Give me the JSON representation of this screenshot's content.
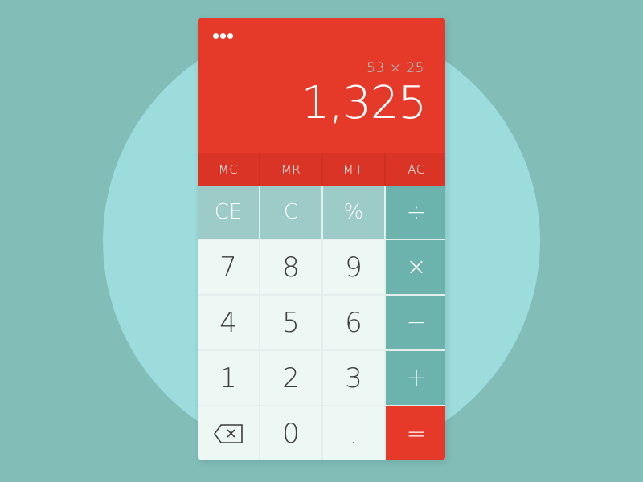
{
  "colors": {
    "background": "#82bdb8",
    "circle": "#9ddcdc",
    "display": "#e5392a",
    "memory_row": "#d93425",
    "function_keys": "#9ccbc8",
    "operator_keys": "#6cb3ae",
    "number_keys": "#edf7f4",
    "equals_key": "#e5392a"
  },
  "display": {
    "menu_icon": "more-horizontal-icon",
    "expression": "53 × 25",
    "result": "1,325"
  },
  "memory_keys": [
    "MC",
    "MR",
    "M+",
    "AC"
  ],
  "function_keys": [
    "CE",
    "C",
    "%"
  ],
  "operators": {
    "divide": "÷",
    "multiply": "×",
    "subtract": "−",
    "add": "+",
    "equals": "="
  },
  "digits": {
    "d7": "7",
    "d8": "8",
    "d9": "9",
    "d4": "4",
    "d5": "5",
    "d6": "6",
    "d1": "1",
    "d2": "2",
    "d3": "3",
    "d0": "0",
    "decimal": "."
  },
  "backspace_icon": "backspace-icon"
}
